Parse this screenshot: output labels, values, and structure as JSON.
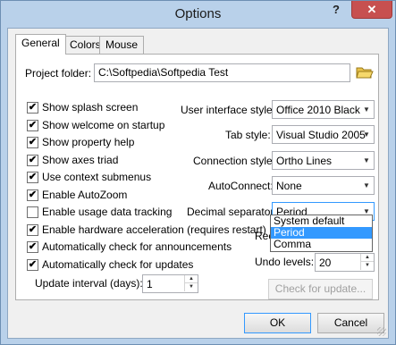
{
  "window": {
    "title": "Options",
    "help_label": "?",
    "close_label": "✕"
  },
  "tabs": [
    {
      "label": "General",
      "active": true
    },
    {
      "label": "Colors",
      "active": false
    },
    {
      "label": "Mouse",
      "active": false
    }
  ],
  "project_folder": {
    "label": "Project folder:",
    "value": "C:\\Softpedia\\Softpedia Test"
  },
  "checkboxes": [
    {
      "label": "Show splash screen",
      "checked": true
    },
    {
      "label": "Show welcome on startup",
      "checked": true
    },
    {
      "label": "Show property help",
      "checked": true
    },
    {
      "label": "Show axes triad",
      "checked": true
    },
    {
      "label": "Use context submenus",
      "checked": true
    },
    {
      "label": "Enable AutoZoom",
      "checked": true
    },
    {
      "label": "Enable usage data tracking",
      "checked": false
    },
    {
      "label": "Enable hardware acceleration (requires restart)",
      "checked": true
    },
    {
      "label": "Automatically check for announcements",
      "checked": true
    },
    {
      "label": "Automatically check for updates",
      "checked": true
    }
  ],
  "update_interval": {
    "label": "Update interval (days):",
    "value": "1"
  },
  "selects": {
    "ui_style": {
      "label": "User interface style:",
      "value": "Office 2010 Black"
    },
    "tab_style": {
      "label": "Tab style:",
      "value": "Visual Studio 2005"
    },
    "connection_style": {
      "label": "Connection style:",
      "value": "Ortho Lines"
    },
    "autoconnect": {
      "label": "AutoConnect:",
      "value": "None"
    },
    "decimal_separator": {
      "label": "Decimal separator:",
      "value": "Period"
    }
  },
  "decimal_options": [
    "System default",
    "Period",
    "Comma"
  ],
  "decimal_selected_index": 1,
  "recent_label_partial": "Rec",
  "undo_levels": {
    "label": "Undo levels:",
    "value": "20"
  },
  "check_update_button": "Check for update...",
  "ok_button": "OK",
  "cancel_button": "Cancel",
  "icons": {
    "folder": "folder-open-icon",
    "check": "✔"
  }
}
